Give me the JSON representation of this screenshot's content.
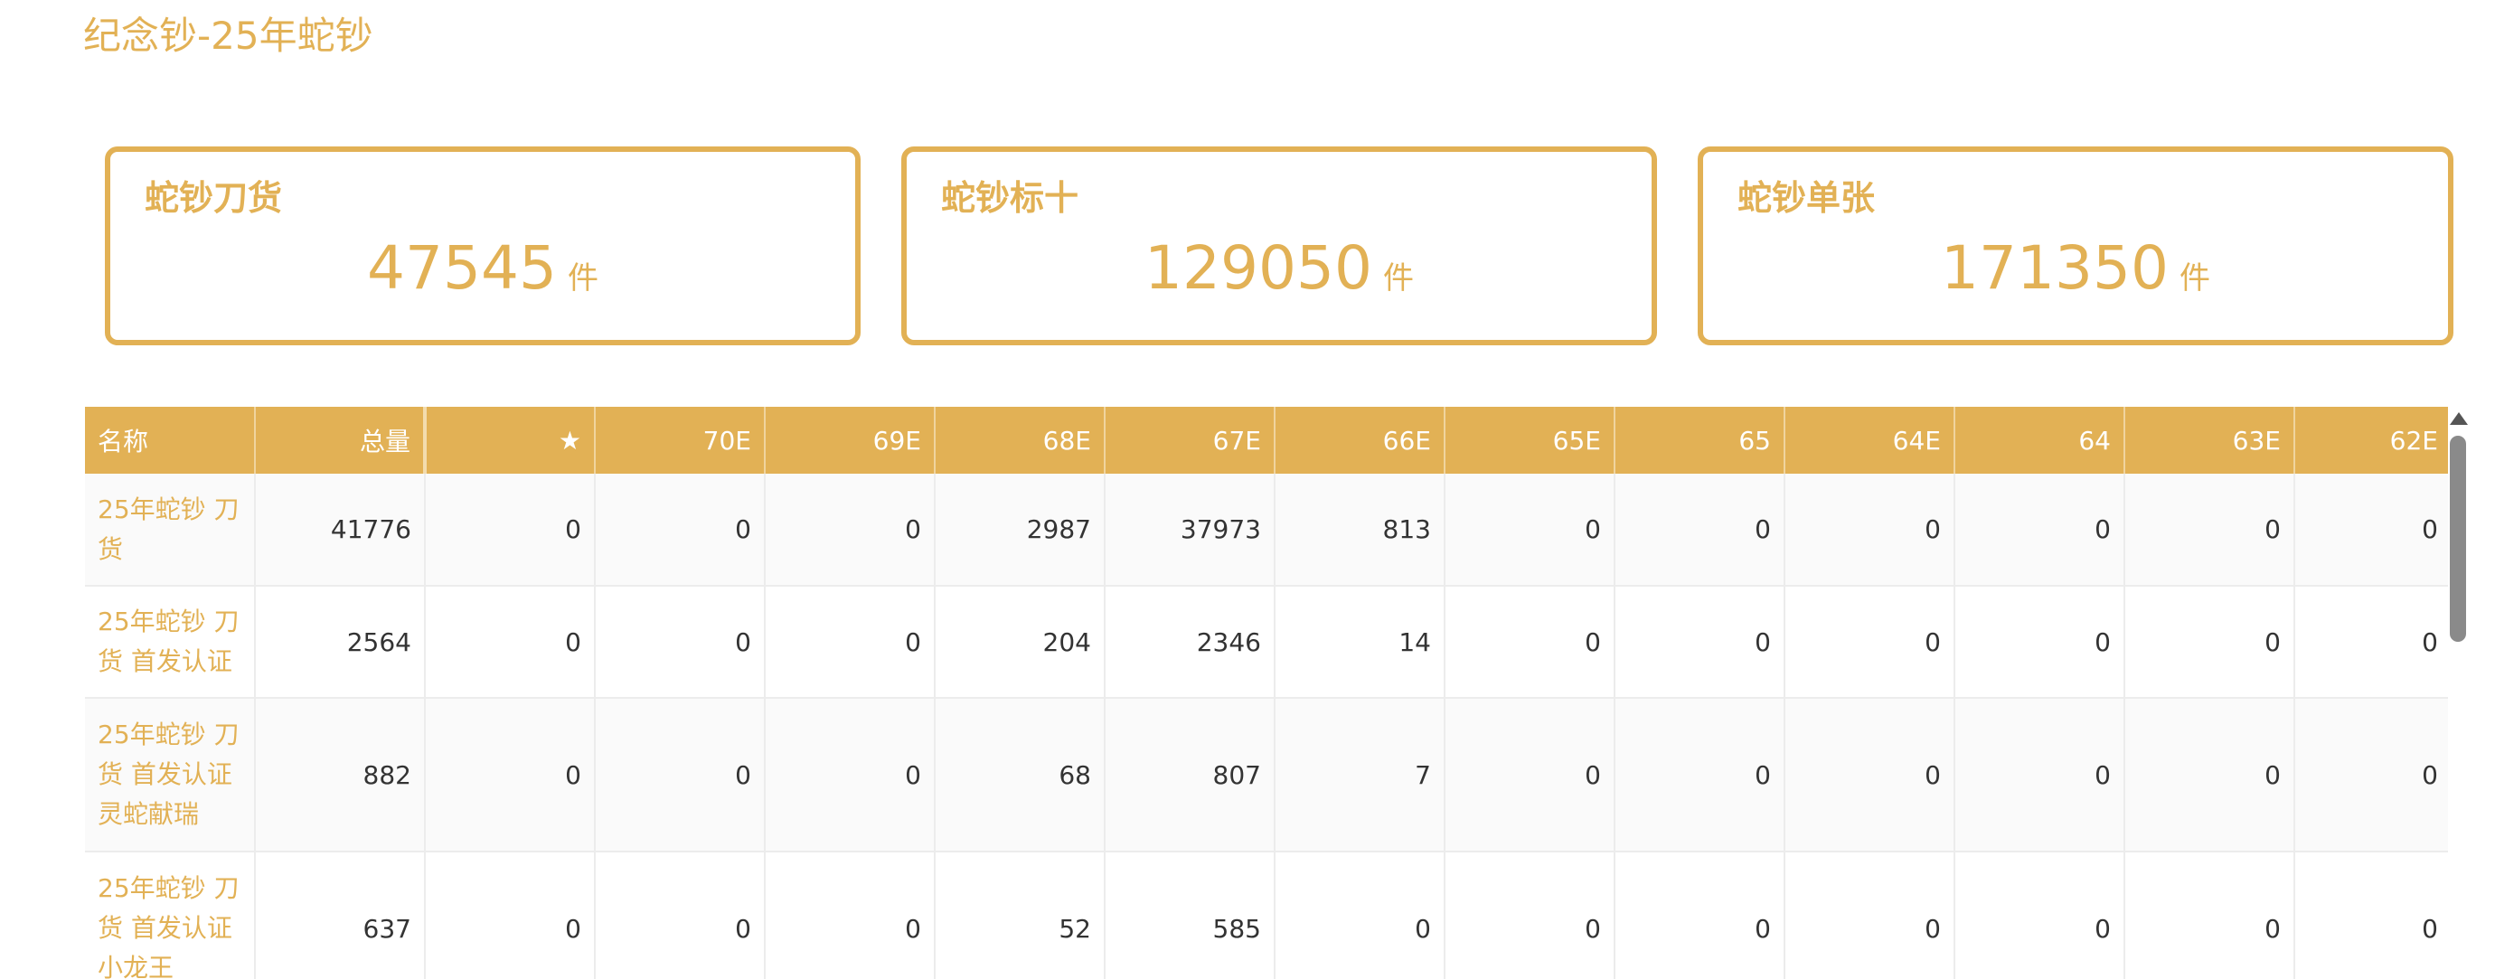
{
  "page": {
    "title": "纪念钞-25年蛇钞"
  },
  "cards": [
    {
      "label": "蛇钞刀货",
      "value": "47545",
      "unit": "件"
    },
    {
      "label": "蛇钞标十",
      "value": "129050",
      "unit": "件"
    },
    {
      "label": "蛇钞单张",
      "value": "171350",
      "unit": "件"
    }
  ],
  "table": {
    "headers": [
      "名称",
      "总量",
      "★",
      "70E",
      "69E",
      "68E",
      "67E",
      "66E",
      "65E",
      "65",
      "64E",
      "64",
      "63E",
      "62E"
    ],
    "rows": [
      {
        "name_lines": [
          "25年蛇钞 刀",
          "货"
        ],
        "cells": [
          "41776",
          "0",
          "0",
          "0",
          "2987",
          "37973",
          "813",
          "0",
          "0",
          "0",
          "0",
          "0",
          "0"
        ]
      },
      {
        "name_lines": [
          "25年蛇钞 刀",
          "货 首发认证"
        ],
        "cells": [
          "2564",
          "0",
          "0",
          "0",
          "204",
          "2346",
          "14",
          "0",
          "0",
          "0",
          "0",
          "0",
          "0"
        ]
      },
      {
        "name_lines": [
          "25年蛇钞 刀",
          "货 首发认证",
          "灵蛇献瑞"
        ],
        "cells": [
          "882",
          "0",
          "0",
          "0",
          "68",
          "807",
          "7",
          "0",
          "0",
          "0",
          "0",
          "0",
          "0"
        ]
      },
      {
        "name_lines": [
          "25年蛇钞 刀",
          "货 首发认证",
          "小龙王"
        ],
        "cells": [
          "637",
          "0",
          "0",
          "0",
          "52",
          "585",
          "0",
          "0",
          "0",
          "0",
          "0",
          "0",
          "0"
        ]
      }
    ]
  },
  "colors": {
    "accent": "#e2b155",
    "header_text": "#ffffff",
    "cell_text": "#333333"
  },
  "icons": {
    "scroll_up": "triangle-up-icon"
  }
}
